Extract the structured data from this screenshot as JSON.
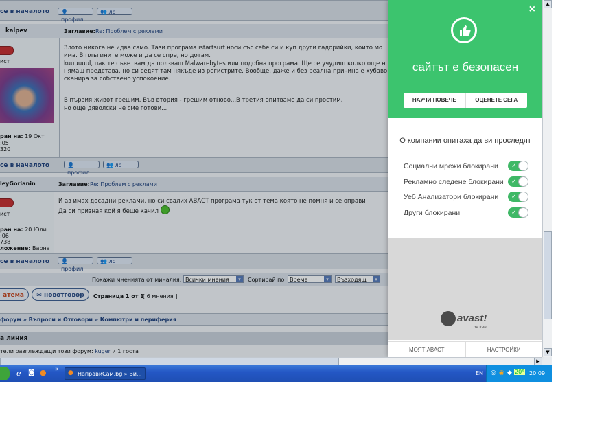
{
  "forum": {
    "to_top_1": "се в началото",
    "profile_btn": "профил",
    "pm_btn": "лс",
    "post1": {
      "author": "kalpev",
      "subject_label": "Заглавие:",
      "subject": "Re: Проблем с реклами",
      "rank": "ист",
      "joined_label": "ран на:",
      "joined": "19 Окт",
      "meta1": ":05",
      "meta2": "320",
      "lines": [
        "Злото никога не идва само. Тази програма istartsurf носи със себе си и куп други гадорийки, които мо",
        "има. В плъгините може и да се спре, но дотам.",
        "kuuuuuul, пак те съветвам да ползваш Malwarebytes или подобна програма. Ще се учудиш колко още н",
        "нямаш представа, но си седят там някъде из регистрите. Вообще, даже и без реална причина е хубаво",
        "сканира за собствено успокоение."
      ],
      "sig1": "В първия живот грешим. Във втория - грешим отново...В третия опитваме да си простим,",
      "sig2": "но още дяволски не сме готови..."
    },
    "to_top_2": "се в началото",
    "post2": {
      "author": "leyGorianin",
      "subject_label": "Заглавие:",
      "subject": "Re: Проблем с реклами",
      "rank": "ист",
      "joined_label": "ран на:",
      "joined": "20 Юли",
      "meta1": ":06",
      "meta2": "738",
      "location_label": "ложение:",
      "location": "Варна",
      "line1": "И аз имах досадни реклами, но си свалих АВАСТ програма тук от тема която не помня и се оправи!",
      "line2": "Да си призная кой я беше качил"
    },
    "to_top_3": "се в началото",
    "sort_bar": {
      "show_label": "Покажи мненията от миналия:",
      "show_value": "Всички мнения",
      "sort_label": "Сортирай по",
      "sort_value": "Време",
      "order_value": "Възходящ"
    },
    "new_topic_btn": "атема",
    "new_reply_btn": "новотговор",
    "page_info_bold": "Страница 1 от 1",
    "page_info_rest": "[ 6 мнения ]",
    "breadcrumb": "форум » Въпроси и Отговори » Компютри и периферия",
    "online_header": "а линия",
    "online_text_prefix": "тели разглеждащи този форум:",
    "online_user": "kuger",
    "online_text_suffix": "и 1 госта"
  },
  "avast_panel": {
    "close": "×",
    "headline": "сайтът е безопасен",
    "learn_more": "НАУЧИ ПОВЕЧЕ",
    "rate_now": "ОЦЕНЕТЕ СЕГА",
    "tracking_title": "О компании опитаха да ви проследят",
    "items": [
      {
        "label": "Социални мрежи блокирани"
      },
      {
        "label": "Рекламно следене блокирани"
      },
      {
        "label": "Уеб Анализатори блокирани"
      },
      {
        "label": "Други блокирани"
      }
    ],
    "brand": "avast!",
    "brand_tagline": "be free",
    "footer_left": "МОЯТ АВАСТ",
    "footer_right": "НАСТРОЙКИ",
    "accent": "#3cc46e"
  },
  "taskbar": {
    "window_title": "НаправиСам.bg » Ви...",
    "lang": "EN",
    "temp": "20°",
    "clock": "20:09"
  }
}
